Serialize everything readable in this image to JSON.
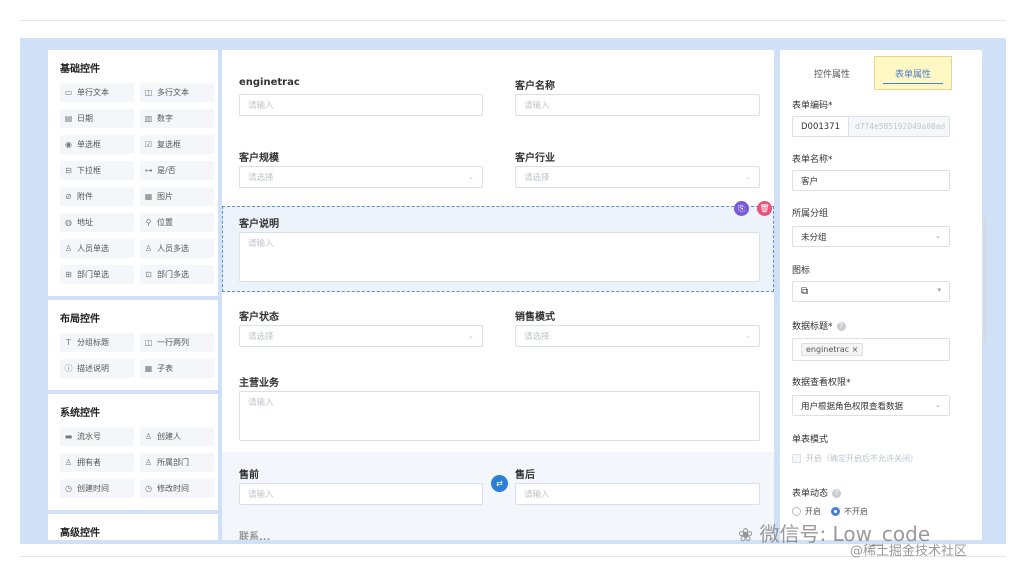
{
  "palette": {
    "groups": [
      {
        "title": "基础控件",
        "items": [
          {
            "label": "单行文本",
            "icon": "▭"
          },
          {
            "label": "多行文本",
            "icon": "◫"
          },
          {
            "label": "日期",
            "icon": "▤"
          },
          {
            "label": "数字",
            "icon": "▥"
          },
          {
            "label": "单选框",
            "icon": "◉"
          },
          {
            "label": "复选框",
            "icon": "☑"
          },
          {
            "label": "下拉框",
            "icon": "⊟"
          },
          {
            "label": "是/否",
            "icon": "⊶"
          },
          {
            "label": "附件",
            "icon": "⊘"
          },
          {
            "label": "图片",
            "icon": "▦"
          },
          {
            "label": "地址",
            "icon": "◍"
          },
          {
            "label": "位置",
            "icon": "⚲"
          },
          {
            "label": "人员单选",
            "icon": "♙"
          },
          {
            "label": "人员多选",
            "icon": "♙"
          },
          {
            "label": "部门单选",
            "icon": "⊞"
          },
          {
            "label": "部门多选",
            "icon": "⊡"
          }
        ]
      },
      {
        "title": "布局控件",
        "items": [
          {
            "label": "分组标题",
            "icon": "T"
          },
          {
            "label": "一行两列",
            "icon": "◫"
          },
          {
            "label": "描述说明",
            "icon": "ⓘ"
          },
          {
            "label": "子表",
            "icon": "▦"
          }
        ]
      },
      {
        "title": "系统控件",
        "items": [
          {
            "label": "流水号",
            "icon": "▬"
          },
          {
            "label": "创建人",
            "icon": "♙"
          },
          {
            "label": "拥有者",
            "icon": "♙"
          },
          {
            "label": "所属部门",
            "icon": "♙"
          },
          {
            "label": "创建时间",
            "icon": "◷"
          },
          {
            "label": "修改时间",
            "icon": "◷"
          }
        ]
      },
      {
        "title": "高级控件",
        "items": []
      }
    ]
  },
  "form": {
    "placeholder_input": "请输入",
    "placeholder_select": "请选择",
    "fields": {
      "enginetrac": "enginetrac",
      "customer_name": "客户名称",
      "customer_scale": "客户规模",
      "customer_industry": "客户行业",
      "customer_desc": "客户说明",
      "customer_status": "客户状态",
      "sales_mode": "销售模式",
      "main_business": "主营业务",
      "presale": "售前",
      "aftersale": "售后",
      "cut_label": "联系..."
    }
  },
  "props": {
    "tabs": [
      "控件属性",
      "表单属性"
    ],
    "active_tab": 1,
    "form_code_label": "表单编码*",
    "form_code_value": "D001371",
    "form_code_hash": "d774e585192049a88ad",
    "form_name_label": "表单名称*",
    "form_name_value": "客户",
    "group_label": "所属分组",
    "group_value": "未分组",
    "icon_label": "图标",
    "data_title_label": "数据标题*",
    "data_title_tag": "enginetrac",
    "data_perm_label": "数据查看权限*",
    "data_perm_value": "用户根据角色权限查看数据",
    "single_mode_label": "单表模式",
    "single_mode_option": "开启（确定开启后不允许关闭）",
    "dynamic_label": "表单动态",
    "dynamic_on": "开启",
    "dynamic_off": "不开启"
  },
  "watermark": {
    "line1": "微信号: Low_code",
    "line2": "@稀土掘金技术社区"
  },
  "colors": {
    "accent": "#4a7fd0",
    "frame": "#cfe0f7",
    "selected_bg": "#edf3fb",
    "copy_btn": "#7b5bd8",
    "delete_btn": "#e9557a",
    "swap_btn": "#2a7fd6"
  }
}
